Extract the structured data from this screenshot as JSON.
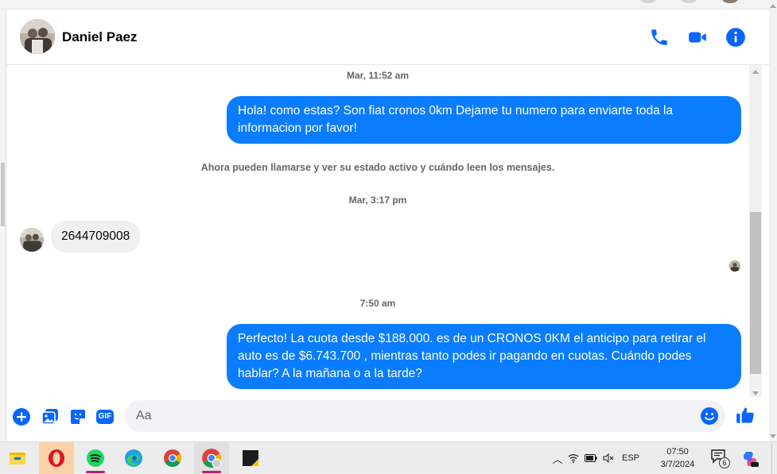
{
  "contact": {
    "name": "Daniel Paez"
  },
  "header_icons": [
    "phone-icon",
    "video-camera-icon",
    "info-icon"
  ],
  "messages": [
    {
      "type": "timestamp",
      "text": "Mar, 11:52 am"
    },
    {
      "type": "outgoing",
      "text": "Hola! como estas? Son fiat cronos 0km Dejame tu numero para enviarte toda la informacion por favor!"
    },
    {
      "type": "system",
      "text": "Ahora pueden llamarse y ver su estado activo y cuándo leen los mensajes."
    },
    {
      "type": "timestamp",
      "text": "Mar, 3:17 pm"
    },
    {
      "type": "incoming",
      "text": "2644709008"
    },
    {
      "type": "timestamp",
      "text": "7:50 am"
    },
    {
      "type": "outgoing",
      "text": "Perfecto! La cuota desde $188.000. es de un CRONOS 0KM el anticipo para retirar el auto es de $6.743.700 , mientras tanto podes ir pagando en cuotas. Cuándo podes hablar? A la mañana o a la tarde?"
    }
  ],
  "composer": {
    "placeholder": "Aa",
    "gif_label": "GIF"
  },
  "colors": {
    "accent": "#0a7cff",
    "icon_blue": "#0866ff",
    "incoming_bubble": "#f0f0f0",
    "muted_text": "#65676b"
  },
  "taskbar": {
    "apps": [
      "file-explorer",
      "opera",
      "spotify",
      "edge",
      "chrome",
      "chrome-profile",
      "sticky-app"
    ],
    "language": "ESP",
    "time": "07:50",
    "date": "3/7/2024",
    "notification_count": "6"
  }
}
